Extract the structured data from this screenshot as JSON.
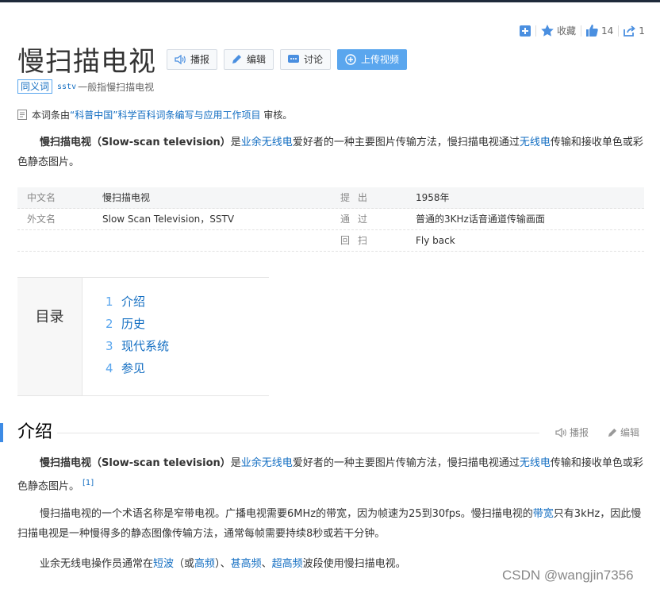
{
  "top_actions": {
    "add_icon": "plus-square-icon",
    "favorite_label": "收藏",
    "like_count": "14",
    "share_count": "1"
  },
  "title": "慢扫描电视",
  "buttons": {
    "play": "播报",
    "edit": "编辑",
    "discuss": "讨论",
    "upload": "上传视频"
  },
  "synonym": {
    "tag": "同义词",
    "code": "sstv",
    "text": "一般指慢扫描电视"
  },
  "reviewed": {
    "prefix": "本词条由",
    "project": "“科普中国”科学百科词条编写与应用工作项目",
    "suffix": " 审核。"
  },
  "intro_para": {
    "term": "慢扫描电视（Slow-scan television）",
    "t1": "是",
    "l1": "业余无线电",
    "t2": "爱好者的一种主要图片传输方法，慢扫描电视通过",
    "l2": "无线电",
    "t3": "传输和接收单色或彩色静态图片。"
  },
  "info_table": [
    {
      "k1": "中文名",
      "v1": "慢扫描电视",
      "k2": "提出",
      "v2": "1958年"
    },
    {
      "k1": "外文名",
      "v1": "Slow Scan Television，SSTV",
      "k2": "通过",
      "v2": "普通的3KHz话音通道传输画面"
    },
    {
      "k1": "",
      "v1": "",
      "k2": "回扫",
      "v2": "Fly back"
    }
  ],
  "catalog": {
    "title": "目录",
    "items": [
      {
        "num": "1",
        "label": "介绍"
      },
      {
        "num": "2",
        "label": "历史"
      },
      {
        "num": "3",
        "label": "现代系统"
      },
      {
        "num": "4",
        "label": "参见"
      }
    ]
  },
  "section": {
    "title": "介绍",
    "play": "播报",
    "edit": "编辑"
  },
  "section_paras": {
    "p1_term": "慢扫描电视（Slow-scan television）",
    "p1_t1": "是",
    "p1_l1": "业余无线电",
    "p1_t2": "爱好者的一种主要图片传输方法，慢扫描电视通过",
    "p1_l2": "无线电",
    "p1_t3": "传输和接收单色或彩色静态图片。",
    "p1_ref": "[1]",
    "p2_t1": "慢扫描电视的一个术语名称是窄带电视。广播电视需要6MHz的带宽，因为帧速为25到30fps。慢扫描电视的",
    "p2_l1": "带宽",
    "p2_t2": "只有3kHz，因此慢扫描电视是一种慢得多的静态图像传输方法，通常每帧需要持续8秒或若干分钟。",
    "p3_t1": "业余无线电操作员通常在",
    "p3_l1": "短波",
    "p3_t2": "（或",
    "p3_l2": "高频",
    "p3_t3": "）、",
    "p3_l3": "甚高频",
    "p3_t4": "、",
    "p3_l4": "超高频",
    "p3_t5": "波段使用慢扫描电视。"
  },
  "watermark": "CSDN @wangjin7356",
  "colors": {
    "link": "#136ec2",
    "accent": "#5aa6ee",
    "section_bar": "#3d8be5"
  }
}
